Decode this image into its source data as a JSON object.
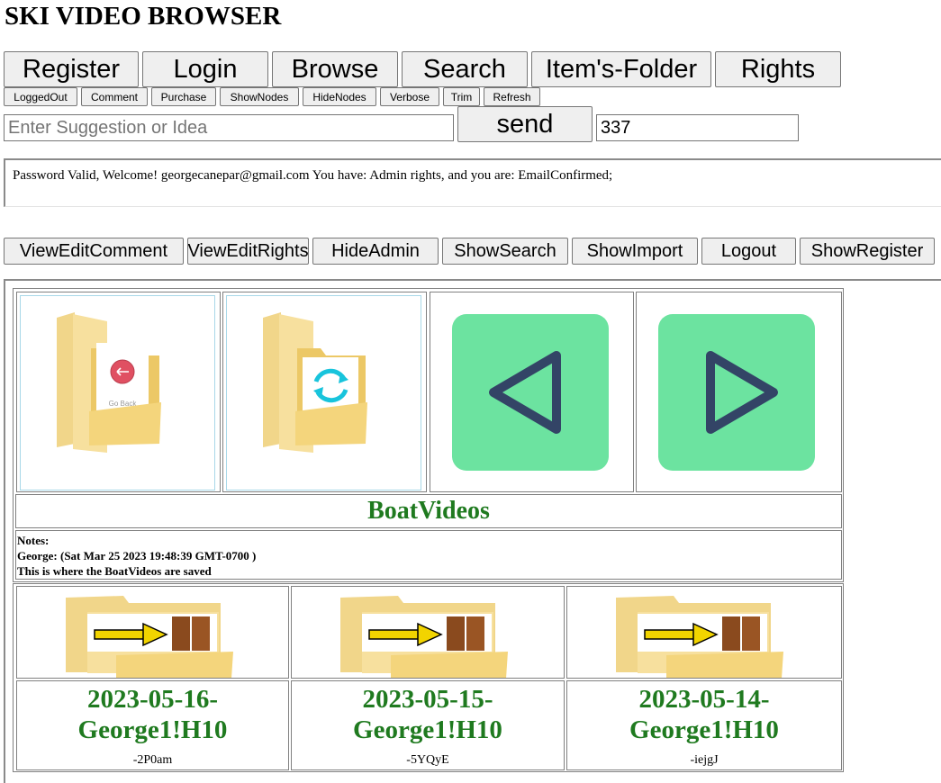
{
  "app": {
    "title": "SKI VIDEO BROWSER"
  },
  "nav": [
    "Register",
    "Login",
    "Browse",
    "Search",
    "Item's-Folder",
    "Rights"
  ],
  "toolbar": [
    "LoggedOut",
    "Comment",
    "Purchase",
    "ShowNodes",
    "HideNodes",
    "Verbose",
    "Trim",
    "Refresh"
  ],
  "suggestion": {
    "placeholder": "Enter Suggestion or Idea",
    "value": "",
    "send_label": "send",
    "count_value": "337"
  },
  "status": {
    "message": "Password Valid, Welcome! georgecanepar@gmail.com You have: Admin rights, and you are: EmailConfirmed;"
  },
  "admin_bar": [
    "ViewEditComment",
    "ViewEditRights",
    "HideAdmin",
    "ShowSearch",
    "ShowImport",
    "Logout",
    "ShowRegister"
  ],
  "folder": {
    "nav_tiles": [
      {
        "label": "Go Back",
        "icon": "go-back-folder-icon"
      },
      {
        "label": "",
        "icon": "refresh-folder-icon"
      },
      {
        "label": "",
        "icon": "previous-icon"
      },
      {
        "label": "",
        "icon": "next-icon"
      }
    ],
    "name": "BoatVideos",
    "notes": {
      "heading": "Notes:",
      "author_line": "George: (Sat Mar 25 2023 19:48:39 GMT-0700 )",
      "text": "This is where the BoatVideos are saved"
    },
    "items": [
      {
        "name_line1": "2023-05-16-",
        "name_line2": "George1!H10",
        "suffix": "-2P0am",
        "icon": "enter-folder-icon"
      },
      {
        "name_line1": "2023-05-15-",
        "name_line2": "George1!H10",
        "suffix": "-5YQyE",
        "icon": "enter-folder-icon"
      },
      {
        "name_line1": "2023-05-14-",
        "name_line2": "George1!H10",
        "suffix": "-iejgJ",
        "icon": "enter-folder-icon"
      }
    ]
  },
  "colors": {
    "folder_name": "#1f7a1f",
    "play_tile": "#6ce3a0",
    "play_arrow": "#334466"
  }
}
